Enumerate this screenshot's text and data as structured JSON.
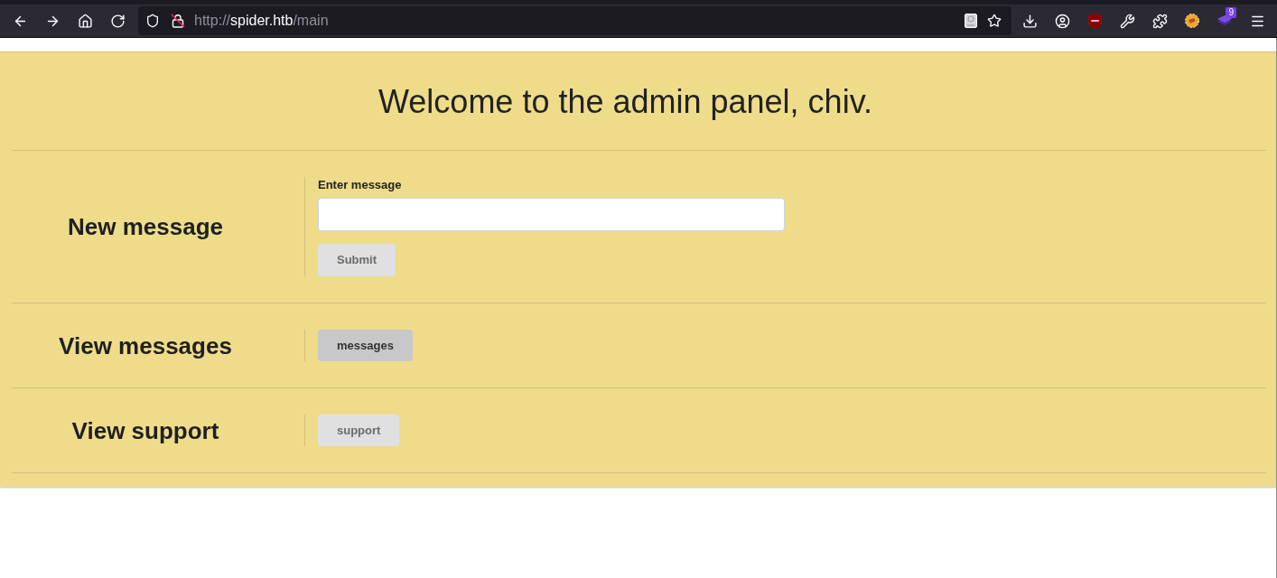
{
  "browser": {
    "url": {
      "scheme": "http://",
      "host": "spider.htb",
      "path": "/main"
    },
    "extension_badge": "9"
  },
  "page": {
    "title": "Welcome to the admin panel, chiv.",
    "sections": [
      {
        "kind": "form",
        "heading": "New message",
        "field": {
          "label": "Enter message"
        },
        "button": {
          "label": "Submit",
          "disabled": true
        }
      },
      {
        "kind": "button",
        "heading": "View messages",
        "button": {
          "label": "messages",
          "disabled": false
        }
      },
      {
        "kind": "button",
        "heading": "View support",
        "button": {
          "label": "support",
          "disabled": true
        }
      }
    ]
  }
}
